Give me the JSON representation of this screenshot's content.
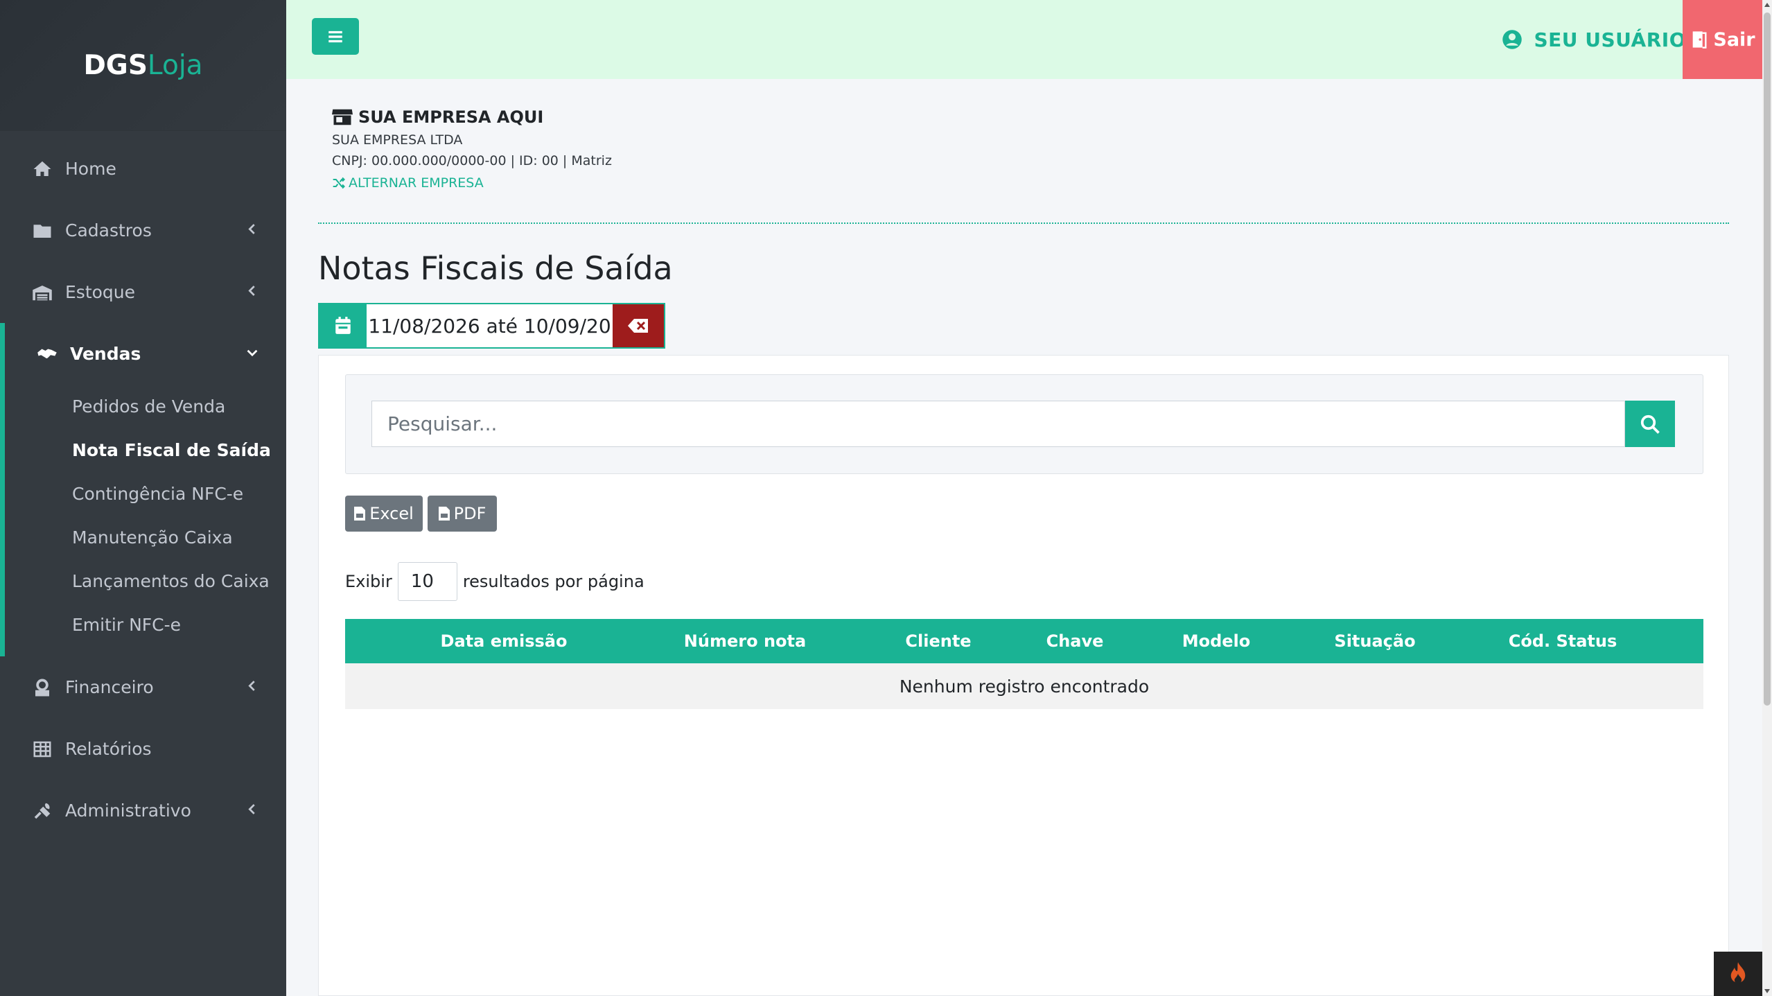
{
  "brand": {
    "part1": "DGS",
    "part2": "Loja"
  },
  "sidebar": {
    "items": [
      {
        "label": "Home",
        "icon": "home-icon"
      },
      {
        "label": "Cadastros",
        "icon": "folder-icon"
      },
      {
        "label": "Estoque",
        "icon": "warehouse-icon"
      },
      {
        "label": "Vendas",
        "icon": "handshake-icon"
      },
      {
        "label": "Financeiro",
        "icon": "money-icon"
      },
      {
        "label": "Relatórios",
        "icon": "table-icon"
      },
      {
        "label": "Administrativo",
        "icon": "tools-icon"
      }
    ],
    "vendas_sub": [
      {
        "label": "Pedidos de Venda"
      },
      {
        "label": "Nota Fiscal de Saída",
        "active": true
      },
      {
        "label": "Contingência NFC-e"
      },
      {
        "label": "Manutenção Caixa"
      },
      {
        "label": "Lançamentos do Caixa"
      },
      {
        "label": "Emitir NFC-e"
      }
    ]
  },
  "header": {
    "user": "SEU USUÁRIO",
    "logout": "Sair"
  },
  "company": {
    "name": "SUA EMPRESA AQUI",
    "legal_name": "SUA EMPRESA LTDA",
    "info": "CNPJ: 00.000.000/0000-00 | ID: 00 | Matriz",
    "switch_label": "ALTERNAR EMPRESA"
  },
  "page": {
    "title": "Notas Fiscais de Saída"
  },
  "filter": {
    "date_range": "11/08/2026 até 10/09/20"
  },
  "search": {
    "placeholder": "Pesquisar..."
  },
  "export": {
    "excel": "Excel",
    "pdf": "PDF"
  },
  "pagination": {
    "prefix": "Exibir",
    "value": "10",
    "suffix": "resultados por página"
  },
  "table": {
    "columns": [
      "Data emissão",
      "Número nota",
      "Cliente",
      "Chave",
      "Modelo",
      "Situação",
      "Cód. Status"
    ],
    "empty_message": "Nenhum registro encontrado"
  },
  "colors": {
    "accent": "#1ab394",
    "sidebar": "#343a40",
    "header_bg": "#dcfae6",
    "logout": "#f1676f",
    "clear": "#9e1c1c"
  }
}
